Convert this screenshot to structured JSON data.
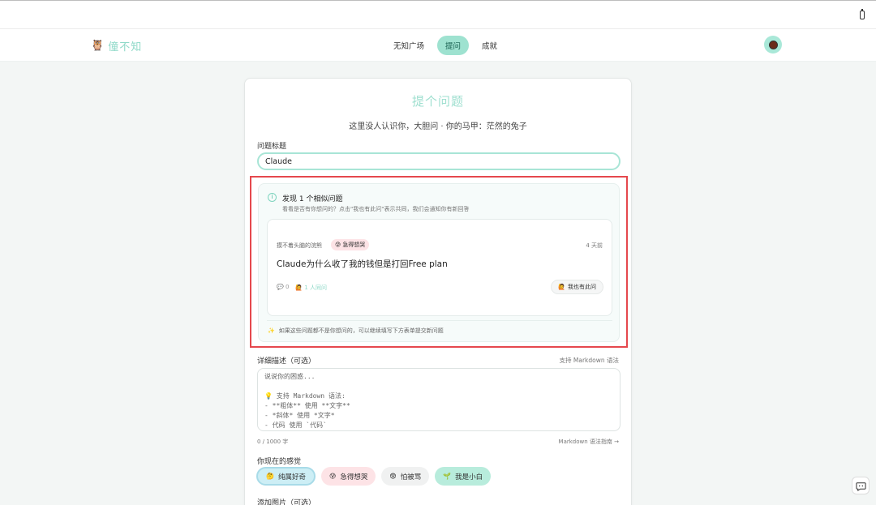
{
  "nav": {
    "logo_text": "僮不知",
    "logo_icon": "🦉",
    "tabs": [
      {
        "label": "无知广场",
        "active": false
      },
      {
        "label": "提问",
        "active": true
      },
      {
        "label": "成就",
        "active": false
      }
    ],
    "accent_color": "#9ee2d0"
  },
  "form": {
    "title": "提个问题",
    "subtitle": "这里没人认识你，大胆问 · 你的马甲：茫然的兔子",
    "title_label": "问题标题",
    "title_value": "Claude",
    "similar": {
      "heading": "发现 1 个相似问题",
      "hint": "看看是否有你想问的？点击\"我也有此问\"表示共同，我们会通知你有新回答",
      "question": {
        "author": "摸不着头脑的浣熊",
        "mood_icon": "😰",
        "mood": "急得想哭",
        "time": "4 天前",
        "title": "Claude为什么收了我的钱但是打回Free plan",
        "comments": "💬 0",
        "asks": "🙋 1 人同问",
        "metoo_icon": "🙋",
        "metoo_label": "我也有此问"
      },
      "footer_icon": "✨",
      "footer": "如果这些问题都不是你想问的，可以继续填写下方表单提交新问题"
    },
    "desc_label": "详细描述（可选）",
    "md_note": "支持 Markdown 语法",
    "desc_placeholder": "说说你的困惑...\n\n💡 支持 Markdown 语法:\n- **粗体** 使用 **文字**\n- *斜体* 使用 *文字*\n- 代码 使用 `代码`",
    "char_count": "0 / 1000 字",
    "md_guide": "Markdown 语法指南 →",
    "mood_label": "你现在的感觉",
    "moods": [
      {
        "icon": "🤔",
        "label": "纯属好奇",
        "bg": "#cdeef5",
        "selected": true
      },
      {
        "icon": "😰",
        "label": "急得想哭",
        "bg": "#fde3e6",
        "selected": false
      },
      {
        "icon": "😨",
        "label": "怕被骂",
        "bg": "#f0f1f1",
        "selected": false
      },
      {
        "icon": "🌱",
        "label": "我是小白",
        "bg": "#b8ecdc",
        "selected": false
      }
    ],
    "image_label": "添加图片（可选）"
  }
}
